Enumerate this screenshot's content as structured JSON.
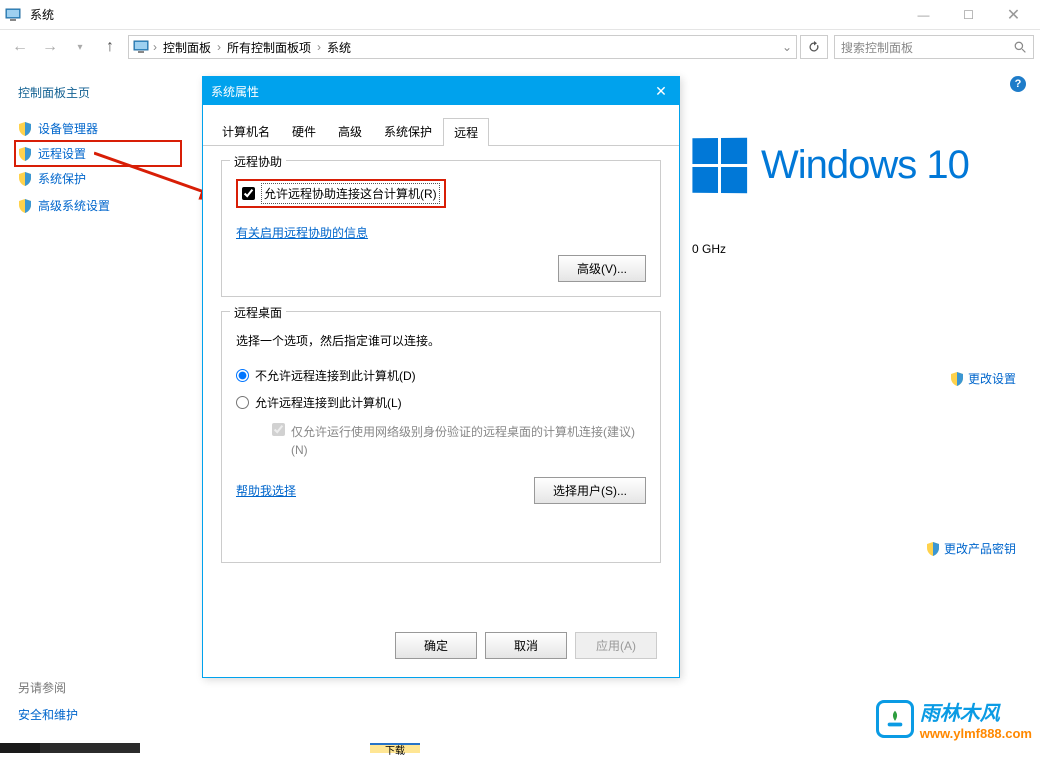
{
  "window": {
    "title": "系统",
    "min": "—",
    "max": "☐",
    "close": "✕"
  },
  "breadcrumbs": [
    "控制面板",
    "所有控制面板项",
    "系统"
  ],
  "search": {
    "placeholder": "搜索控制面板"
  },
  "sidebar": {
    "heading": "控制面板主页",
    "items": [
      {
        "label": "设备管理器"
      },
      {
        "label": "远程设置"
      },
      {
        "label": "系统保护"
      },
      {
        "label": "高级系统设置"
      }
    ],
    "see_also": "另请参阅",
    "security_link": "安全和维护"
  },
  "right": {
    "win10_label": "Windows 10",
    "ghz": "0 GHz",
    "change_settings": "更改设置",
    "change_key": "更改产品密钥"
  },
  "dialog": {
    "title": "系统属性",
    "tabs": [
      "计算机名",
      "硬件",
      "高级",
      "系统保护",
      "远程"
    ],
    "active_tab": 4,
    "group1": {
      "title": "远程协助",
      "checkbox": "允许远程协助连接这台计算机(R)",
      "link": "有关启用远程协助的信息",
      "advanced_btn": "高级(V)..."
    },
    "group2": {
      "title": "远程桌面",
      "desc": "选择一个选项，然后指定谁可以连接。",
      "radio1": "不允许远程连接到此计算机(D)",
      "radio2": "允许远程连接到此计算机(L)",
      "sub_chk": "仅允许运行使用网络级别身份验证的远程桌面的计算机连接(建议)(N)",
      "help_link": "帮助我选择",
      "select_users_btn": "选择用户(S)..."
    },
    "buttons": {
      "ok": "确定",
      "cancel": "取消",
      "apply": "应用(A)"
    }
  },
  "watermark": {
    "name": "雨林木风",
    "url": "www.ylmf888.com"
  },
  "bottomedge": {
    "download": "下载"
  }
}
